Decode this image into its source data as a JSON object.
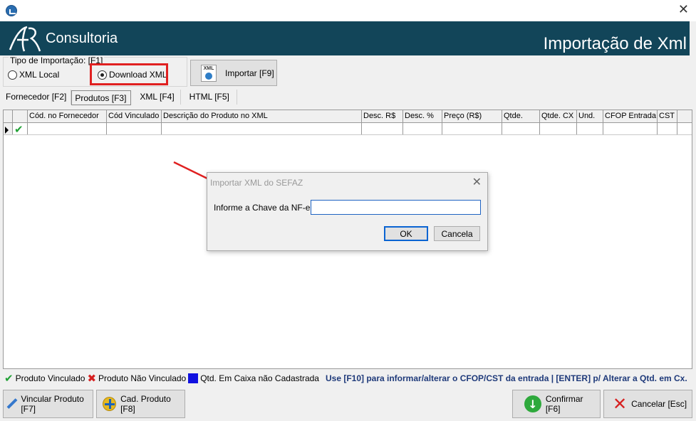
{
  "window": {
    "close_glyph": "✕"
  },
  "banner": {
    "brand": "Consultoria",
    "title": "Importação de Xml"
  },
  "import_type": {
    "legend": "Tipo de Importação: [F1]",
    "options": [
      {
        "label": "XML Local",
        "checked": false
      },
      {
        "label": "Download XML",
        "checked": true
      }
    ],
    "import_button": "Importar [F9]",
    "xml_icon_text": "XML"
  },
  "tabs": [
    "Fornecedor [F2]",
    "Produtos [F3]",
    "XML [F4]",
    "HTML [F5]"
  ],
  "active_tab": "Produtos [F3]",
  "grid": {
    "columns": [
      "Cód. no Fornecedor",
      "Cód Vinculado",
      "Descrição do Produto no XML",
      "Desc. R$",
      "Desc. %",
      "Preço (R$)",
      "Qtde.",
      "Qtde. CX",
      "Und.",
      "CFOP Entrada",
      "CST"
    ],
    "row_status_icon": "✔"
  },
  "dialog": {
    "title": "Importar XML do SEFAZ",
    "close_glyph": "✕",
    "label": "Informe a Chave da NF-e:",
    "input_value": "",
    "ok": "OK",
    "cancel": "Cancela"
  },
  "legend": {
    "vinculado": "Produto Vinculado",
    "nao_vinculado": "Produto Não Vinculado",
    "caixa": "Qtd. Em Caixa não Cadastrada",
    "hint": "Use [F10] para informar/alterar o CFOP/CST da entrada | [ENTER] p/ Alterar a Qtd. em Cx.",
    "check_glyph": "✔",
    "x_glyph": "✖"
  },
  "footer": {
    "vincular": "Vincular Produto [F7]",
    "cad": "Cad. Produto [F8]",
    "confirmar": "Confirmar [F6]",
    "cancelar": "Cancelar [Esc]",
    "confirm_glyph": "↓",
    "cancel_glyph": "✕"
  },
  "colors": {
    "banner": "#124559",
    "highlight": "#e02020",
    "hint": "#1f3a7a",
    "check": "#21a135"
  }
}
